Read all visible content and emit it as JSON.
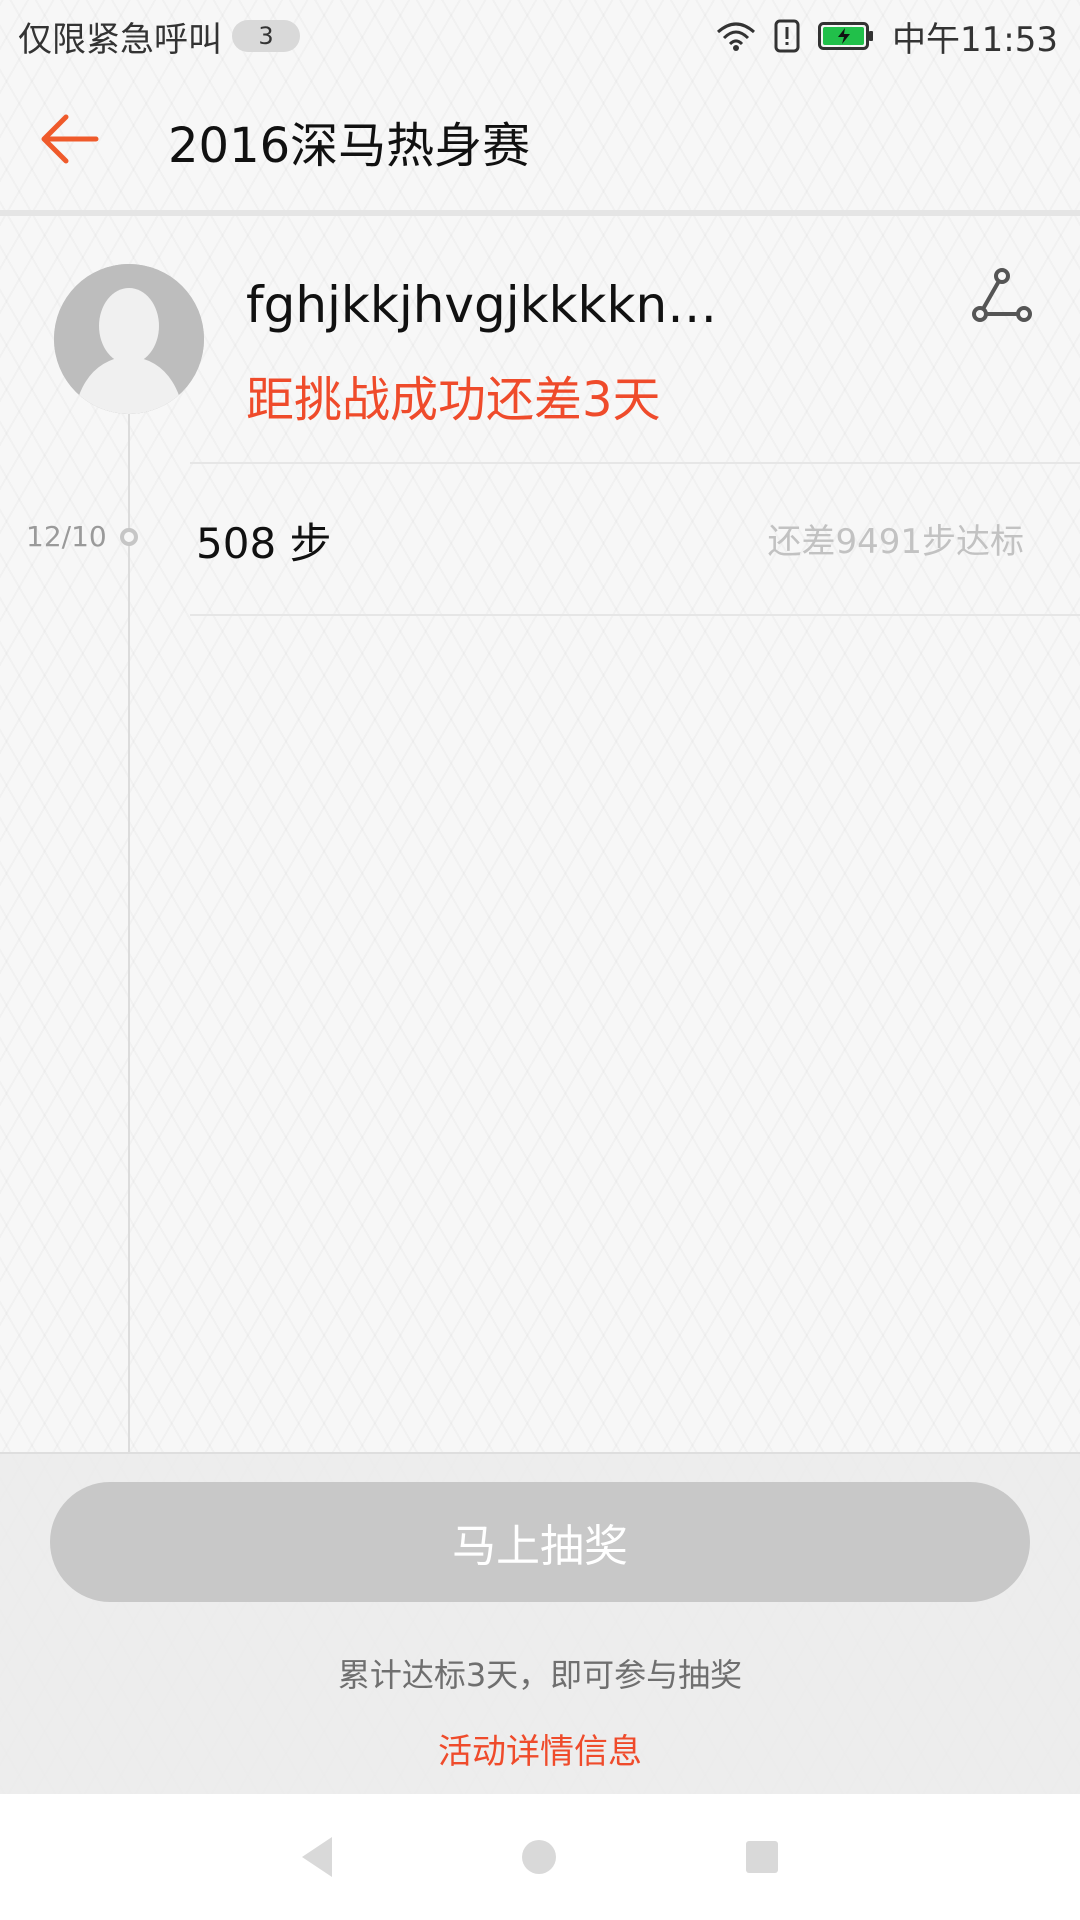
{
  "status_bar": {
    "left_text": "仅限紧急呼叫",
    "badge": "3",
    "time": "中午11:53",
    "icons": [
      "wifi-icon",
      "alert-icon",
      "battery-charging-icon"
    ],
    "battery_color": "#21c04a"
  },
  "header": {
    "title": "2016深马热身赛",
    "back_icon": "arrow-left-icon",
    "accent": "#ef5a2b"
  },
  "profile": {
    "username": "fghjkkjhvgjkkkkn…",
    "remaining": "距挑战成功还差3天",
    "share_icon": "share-icon"
  },
  "records": [
    {
      "date": "12/10",
      "steps": "508 步",
      "diff": "还差9491步达标"
    }
  ],
  "actions": {
    "lottery_button": "马上抽奖",
    "hint": "累计达标3天，即可参与抽奖",
    "detail_link": "活动详情信息"
  },
  "nav": {
    "icons": [
      "nav-back-icon",
      "nav-home-icon",
      "nav-recent-icon"
    ]
  },
  "colors": {
    "highlight": "#ef4b2b",
    "disabled_button": "#c8c8c8"
  }
}
